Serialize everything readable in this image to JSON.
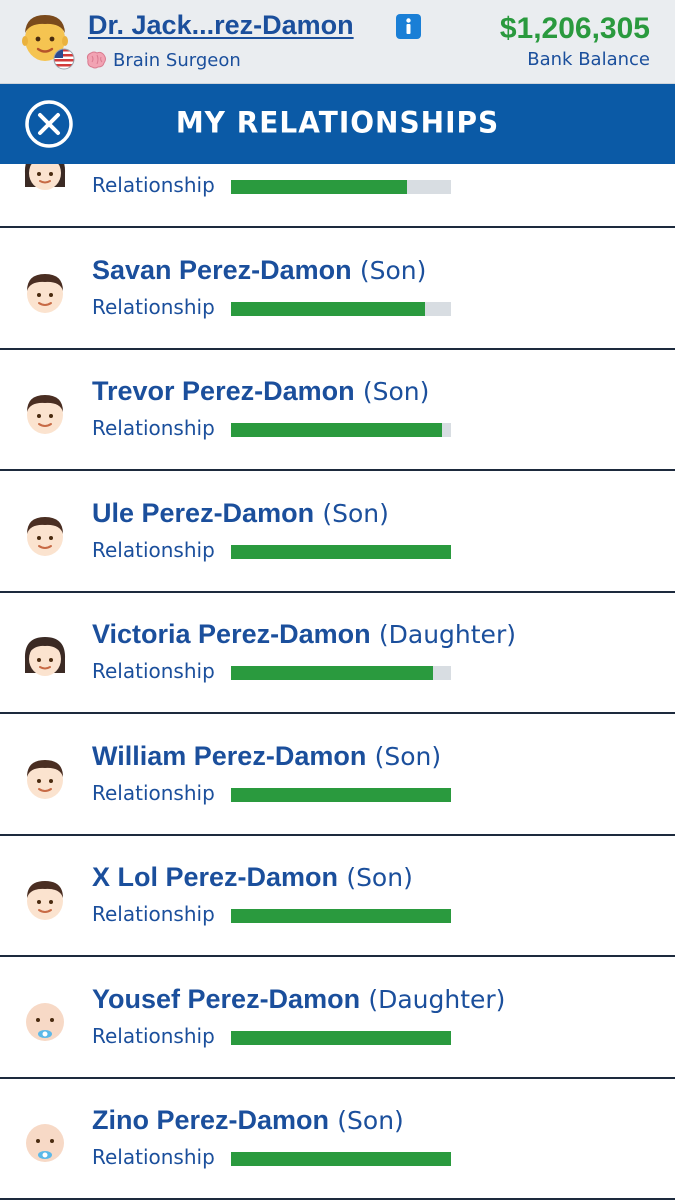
{
  "header": {
    "character_name": "Dr. Jack...rez-Damon",
    "occupation": "Brain Surgeon",
    "balance": "$1,206,305",
    "balance_label": "Bank Balance"
  },
  "titlebar": {
    "title": "MY RELATIONSHIPS"
  },
  "relationship_label": "Relationship",
  "relationships": [
    {
      "name": "",
      "relation": "",
      "level": 0.8,
      "avatar": "girl-face-icon"
    },
    {
      "name": "Savan Perez-Damon",
      "relation": "(Son)",
      "level": 0.88,
      "avatar": "boy-face-icon"
    },
    {
      "name": "Trevor Perez-Damon",
      "relation": "(Son)",
      "level": 0.96,
      "avatar": "boy-face-icon"
    },
    {
      "name": "Ule Perez-Damon",
      "relation": "(Son)",
      "level": 1.0,
      "avatar": "boy-face-icon"
    },
    {
      "name": "Victoria Perez-Damon",
      "relation": "(Daughter)",
      "level": 0.92,
      "avatar": "girl-face-icon"
    },
    {
      "name": "William Perez-Damon",
      "relation": "(Son)",
      "level": 1.0,
      "avatar": "boy-face-icon"
    },
    {
      "name": "X Lol Perez-Damon",
      "relation": "(Son)",
      "level": 1.0,
      "avatar": "boy-face-icon"
    },
    {
      "name": "Yousef Perez-Damon",
      "relation": "(Daughter)",
      "level": 1.0,
      "avatar": "baby-face-icon"
    },
    {
      "name": "Zino Perez-Damon",
      "relation": "(Son)",
      "level": 1.0,
      "avatar": "baby-face-icon"
    }
  ],
  "colors": {
    "header_bg": "#eaedf0",
    "titlebar_bg": "#0b5aa6",
    "name_blue": "#1b4f9c",
    "bar_green": "#2a9a3e",
    "bar_track": "#d8dde2"
  }
}
